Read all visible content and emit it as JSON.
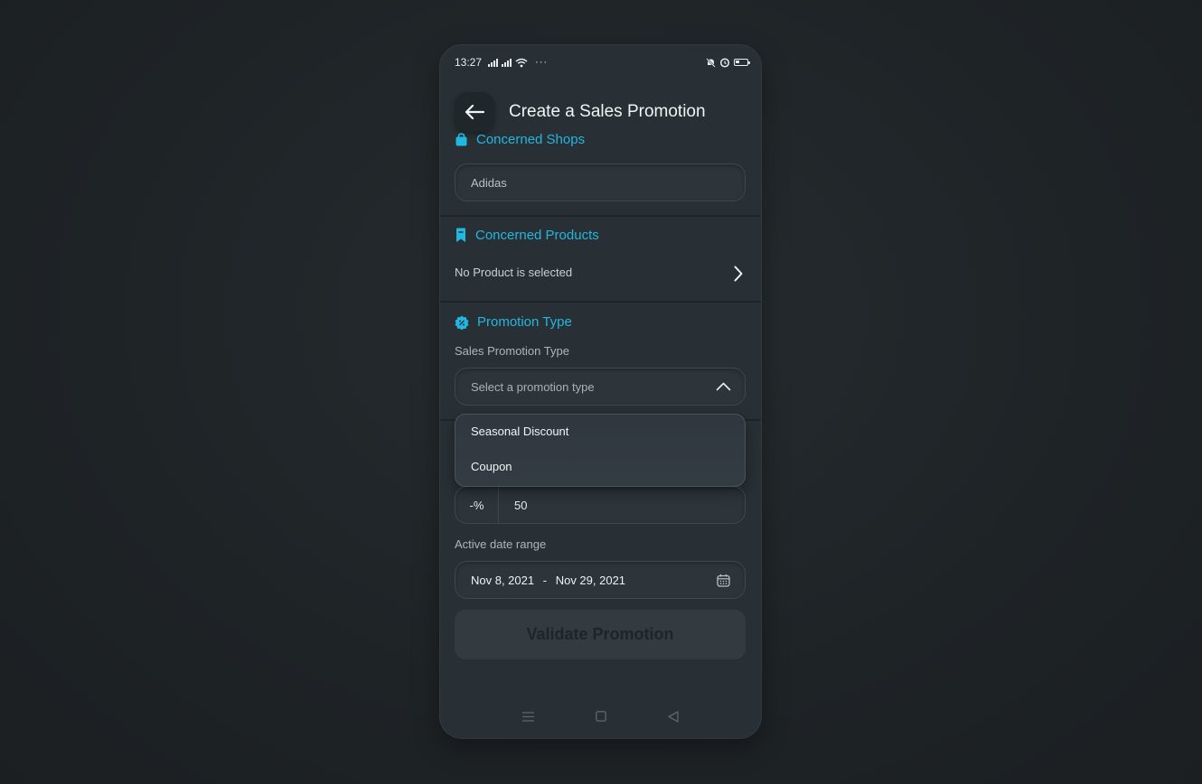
{
  "status_bar": {
    "time": "13:27",
    "more": "···"
  },
  "header": {
    "title": "Create a Sales Promotion",
    "back_icon": "arrow-left-icon"
  },
  "concerned_shops": {
    "title": "Concerned Shops",
    "icon": "shopping-bag-icon",
    "value": "Adidas"
  },
  "concerned_products": {
    "title": "Concerned Products",
    "icon": "bookmark-icon",
    "value": "No Product is selected"
  },
  "promotion_type": {
    "title": "Promotion Type",
    "icon": "discount-badge-icon",
    "label": "Sales Promotion Type",
    "placeholder": "Select a promotion type",
    "options": [
      "Seasonal Discount",
      "Coupon"
    ]
  },
  "discount": {
    "prefix": "-%",
    "value": "50"
  },
  "date_range": {
    "label": "Active date range",
    "start": "Nov 8, 2021",
    "separator": "-",
    "end": "Nov 29, 2021"
  },
  "validate_button": {
    "label": "Validate Promotion"
  },
  "colors": {
    "accent": "#22b7e0",
    "background": "#283035",
    "text": "#d7dde0"
  }
}
